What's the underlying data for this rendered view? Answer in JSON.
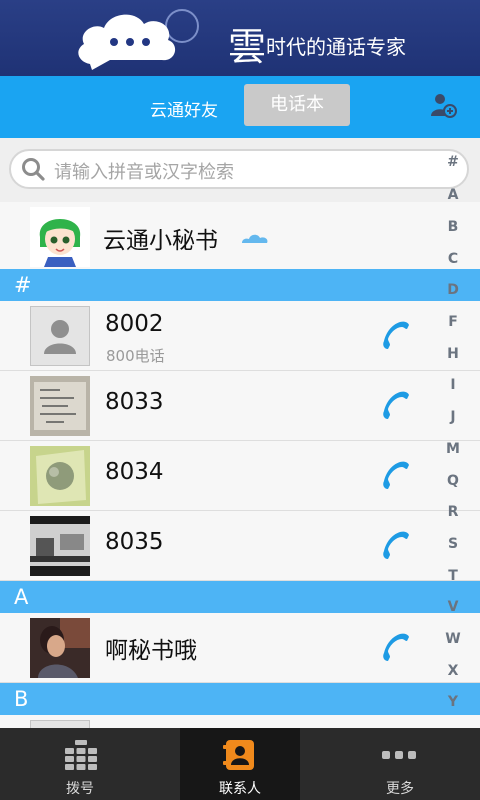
{
  "banner": {
    "big_char": "雲",
    "slogan": "时代的通话专家"
  },
  "tabs": {
    "yuntong_friends": "云通好友",
    "phonebook": "电话本"
  },
  "search": {
    "placeholder": "请输入拼音或汉字检索"
  },
  "secretary": {
    "name": "云通小秘书"
  },
  "sections": [
    "#",
    "A",
    "B"
  ],
  "contacts": [
    {
      "name": "8002",
      "sub": "800电话"
    },
    {
      "name": "8033"
    },
    {
      "name": "8034"
    },
    {
      "name": "8035"
    },
    {
      "name": "啊秘书哦"
    }
  ],
  "index_letters": [
    "#",
    "A",
    "B",
    "C",
    "D",
    "F",
    "H",
    "I",
    "J",
    "M",
    "Q",
    "R",
    "S",
    "T",
    "V",
    "W",
    "X",
    "Y"
  ],
  "bottom_nav": [
    {
      "label": "拨号",
      "icon": "dialpad-icon"
    },
    {
      "label": "联系人",
      "icon": "contacts-icon",
      "active": true
    },
    {
      "label": "更多",
      "icon": "more-icon"
    }
  ],
  "colors": {
    "accent": "#1aa4f2",
    "section": "#4db4f5",
    "banner": "#233783",
    "call": "#1e9be4"
  }
}
